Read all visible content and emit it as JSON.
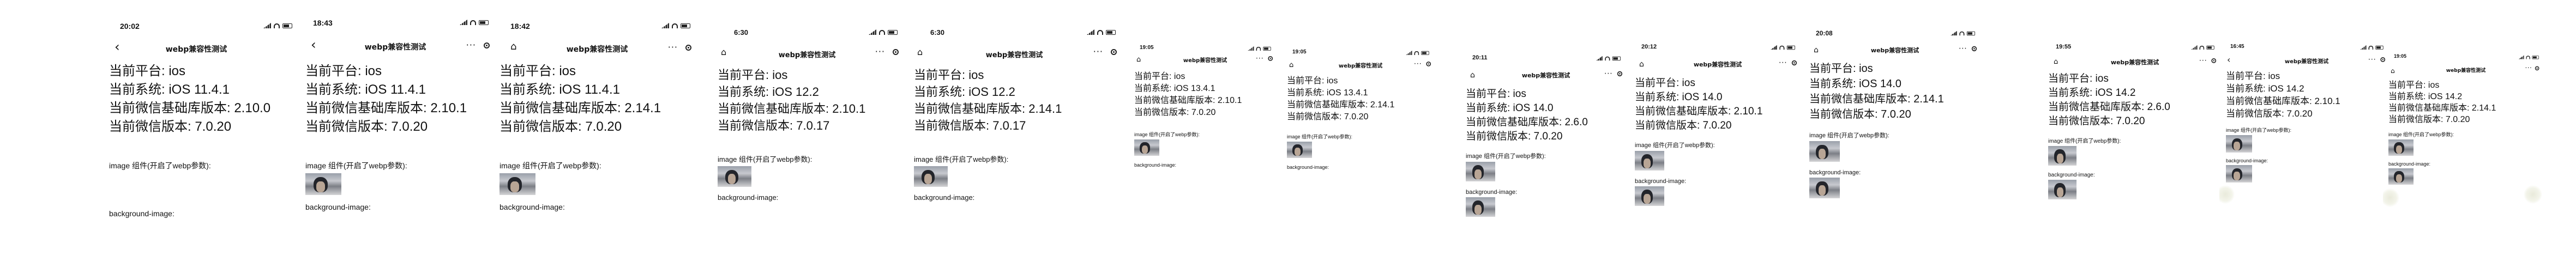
{
  "nav_title": "webp兼容性测试",
  "labels": {
    "image_label": "image 组件(开启了webp参数):",
    "background_label": "background-image:"
  },
  "screens": [
    {
      "time": "20:02",
      "platform": "当前平台: ios",
      "system": "当前系统: iOS 11.4.1",
      "sdk": "当前微信基础库版本: 2.10.0",
      "wechat": "当前微信版本: 7.0.20",
      "show_image": false,
      "show_bg": false
    },
    {
      "time": "18:43",
      "platform": "当前平台: ios",
      "system": "当前系统: iOS 11.4.1",
      "sdk": "当前微信基础库版本: 2.10.1",
      "wechat": "当前微信版本: 7.0.20",
      "show_image": true,
      "show_bg": false
    },
    {
      "time": "18:42",
      "platform": "当前平台: ios",
      "system": "当前系统: iOS 11.4.1",
      "sdk": "当前微信基础库版本: 2.14.1",
      "wechat": "当前微信版本: 7.0.20",
      "show_image": true,
      "show_bg": false
    },
    {
      "time": "6:30",
      "platform": "当前平台: ios",
      "system": "当前系统: iOS 12.2",
      "sdk": "当前微信基础库版本: 2.10.1",
      "wechat": "当前微信版本: 7.0.17",
      "show_image": true,
      "show_bg": false
    },
    {
      "time": "6:30",
      "platform": "当前平台: ios",
      "system": "当前系统: iOS 12.2",
      "sdk": "当前微信基础库版本: 2.14.1",
      "wechat": "当前微信版本: 7.0.17",
      "show_image": true,
      "show_bg": false
    },
    {
      "time": "19:05",
      "platform": "当前平台: ios",
      "system": "当前系统: iOS 13.4.1",
      "sdk": "当前微信基础库版本: 2.10.1",
      "wechat": "当前微信版本: 7.0.20",
      "show_image": true,
      "show_bg": false
    },
    {
      "time": "19:05",
      "platform": "当前平台: ios",
      "system": "当前系统: iOS 13.4.1",
      "sdk": "当前微信基础库版本: 2.14.1",
      "wechat": "当前微信版本: 7.0.20",
      "show_image": true,
      "show_bg": false
    },
    {
      "time": "20:11",
      "platform": "当前平台: ios",
      "system": "当前系统: iOS 14.0",
      "sdk": "当前微信基础库版本: 2.6.0",
      "wechat": "当前微信版本: 7.0.20",
      "show_image": true,
      "show_bg": true
    },
    {
      "time": "20:12",
      "platform": "当前平台: ios",
      "system": "当前系统: iOS 14.0",
      "sdk": "当前微信基础库版本: 2.10.1",
      "wechat": "当前微信版本: 7.0.20",
      "show_image": true,
      "show_bg": true
    },
    {
      "time": "20:08",
      "platform": "当前平台: ios",
      "system": "当前系统: iOS 14.0",
      "sdk": "当前微信基础库版本: 2.14.1",
      "wechat": "当前微信版本: 7.0.20",
      "show_image": true,
      "show_bg": true
    },
    {
      "time": "19:55",
      "platform": "当前平台: ios",
      "system": "当前系统: iOS 14.2",
      "sdk": "当前微信基础库版本: 2.6.0",
      "wechat": "当前微信版本: 7.0.20",
      "show_image": true,
      "show_bg": true
    },
    {
      "time": "16:45",
      "platform": "当前平台: ios",
      "system": "当前系统: iOS 14.2",
      "sdk": "当前微信基础库版本: 2.10.1",
      "wechat": "当前微信版本: 7.0.20",
      "show_image": true,
      "show_bg": true
    },
    {
      "time": "19:05",
      "platform": "当前平台: ios",
      "system": "当前系统: iOS 14.2",
      "sdk": "当前微信基础库版本: 2.14.1",
      "wechat": "当前微信版本: 7.0.20",
      "show_image": true,
      "show_bg": true
    }
  ]
}
